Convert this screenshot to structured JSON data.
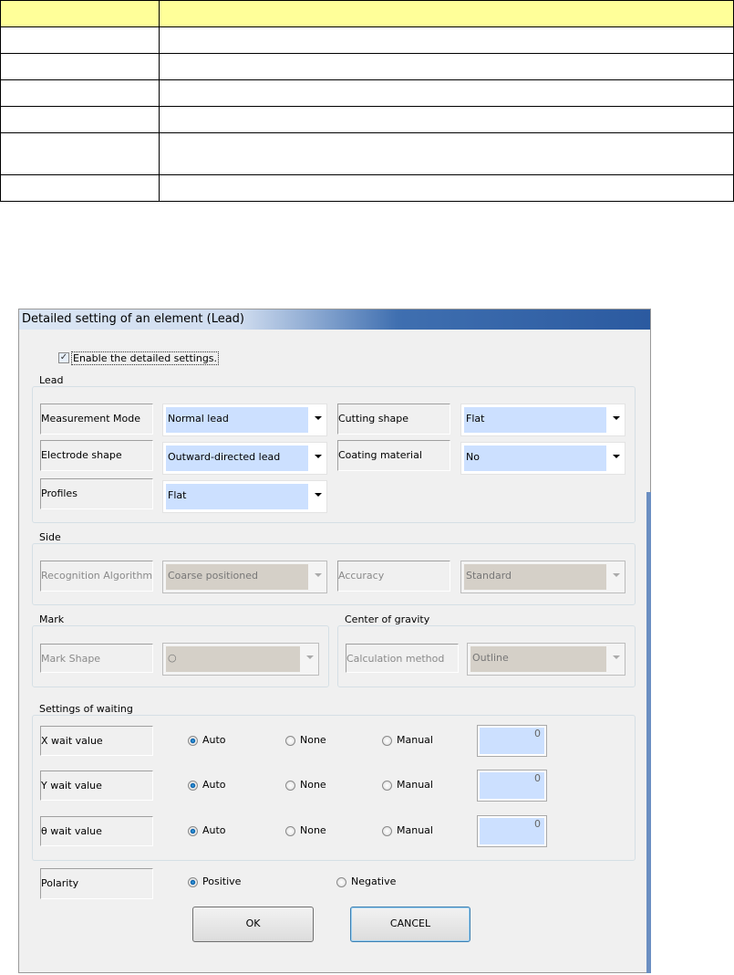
{
  "dialog": {
    "title": "Detailed setting of an element  (Lead)",
    "enable_label": "Enable the detailed settings.",
    "enable_checked": true,
    "lead": {
      "legend": "Lead",
      "measurement_mode": {
        "label": "Measurement Mode",
        "value": "Normal lead"
      },
      "cutting_shape": {
        "label": "Cutting shape",
        "value": "Flat"
      },
      "electrode_shape": {
        "label": "Electrode shape",
        "value": "Outward-directed lead"
      },
      "coating_material": {
        "label": "Coating material",
        "value": "No"
      },
      "profiles": {
        "label": "Profiles",
        "value": "Flat"
      }
    },
    "side": {
      "legend": "Side",
      "recognition": {
        "label": "Recognition Algorithm",
        "value": "Coarse positioned"
      },
      "accuracy": {
        "label": "Accuracy",
        "value": "Standard"
      }
    },
    "mark": {
      "legend": "Mark",
      "shape": {
        "label": "Mark Shape",
        "value": "○"
      }
    },
    "cog": {
      "legend": "Center of gravity",
      "method": {
        "label": "Calculation method",
        "value": "Outline"
      }
    },
    "waiting": {
      "legend": "Settings of waiting",
      "options": [
        "Auto",
        "None",
        "Manual"
      ],
      "rows": [
        {
          "label": "X wait value",
          "selected": "Auto",
          "value": "0"
        },
        {
          "label": "Y wait value",
          "selected": "Auto",
          "value": "0"
        },
        {
          "label": "θ wait value",
          "selected": "Auto",
          "value": "0"
        }
      ]
    },
    "polarity": {
      "label": "Polarity",
      "positive": "Positive",
      "negative": "Negative",
      "selected": "Positive"
    },
    "ok": "OK",
    "cancel": "CANCEL"
  }
}
